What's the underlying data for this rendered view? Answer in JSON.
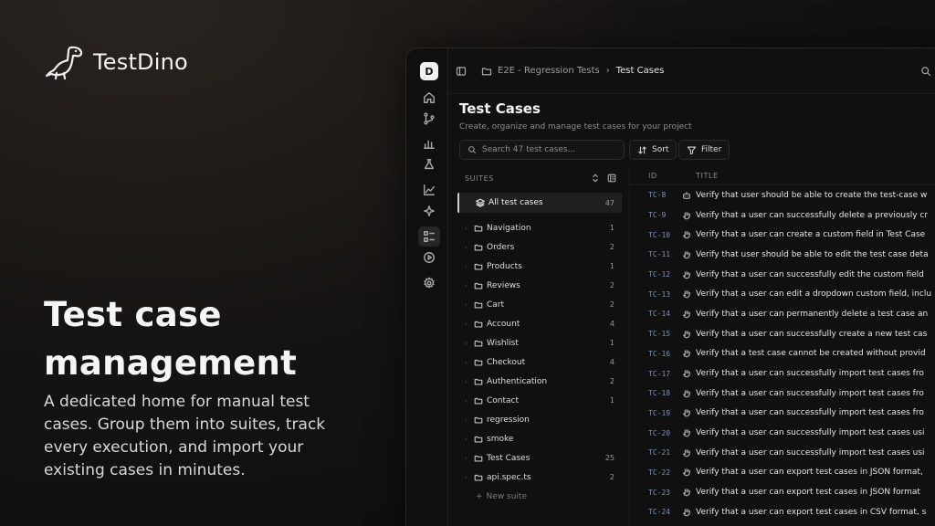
{
  "brand": {
    "name": "TestDino"
  },
  "hero": {
    "headline": "Test case management",
    "description": "A dedicated home for manual test cases. Group them into suites, track every execution, and import your existing cases in minutes."
  },
  "app": {
    "workspace_initial": "D",
    "breadcrumb": {
      "project": "E2E - Regression Tests",
      "page": "Test Cases"
    },
    "page_title": "Test Cases",
    "page_subtitle": "Create, organize and manage test cases for your project",
    "search_placeholder": "Search 47 test cases...",
    "sort_label": "Sort",
    "filter_label": "Filter",
    "suites_header": "SUITES",
    "all_cases": {
      "label": "All test cases",
      "count": "47"
    },
    "suites": [
      {
        "name": "Navigation",
        "count": "1"
      },
      {
        "name": "Orders",
        "count": "2"
      },
      {
        "name": "Products",
        "count": "1"
      },
      {
        "name": "Reviews",
        "count": "2"
      },
      {
        "name": "Cart",
        "count": "2"
      },
      {
        "name": "Account",
        "count": "4"
      },
      {
        "name": "Wishlist",
        "count": "1"
      },
      {
        "name": "Checkout",
        "count": "4"
      },
      {
        "name": "Authentication",
        "count": "2"
      },
      {
        "name": "Contact",
        "count": "1"
      },
      {
        "name": "regression",
        "count": ""
      },
      {
        "name": "smoke",
        "count": ""
      },
      {
        "name": "Test Cases",
        "count": "25"
      },
      {
        "name": "api.spec.ts",
        "count": "2"
      }
    ],
    "new_suite_label": "New suite",
    "table_headers": {
      "id": "ID",
      "title": "TITLE"
    },
    "cases": [
      {
        "id": "TC-8",
        "icon": "robot-icon",
        "title": "Verify that user should be able to create the test-case w"
      },
      {
        "id": "TC-9",
        "icon": "hand-icon",
        "title": "Verify that a user can successfully delete a previously cr"
      },
      {
        "id": "TC-10",
        "icon": "hand-icon",
        "title": "Verify that a user can create a custom field in Test Case"
      },
      {
        "id": "TC-11",
        "icon": "hand-icon",
        "title": "Verify that user should be able to edit the test case deta"
      },
      {
        "id": "TC-12",
        "icon": "hand-icon",
        "title": "Verify that a user can successfully edit the custom field"
      },
      {
        "id": "TC-13",
        "icon": "hand-icon",
        "title": "Verify that a user can edit a dropdown custom field, inclu"
      },
      {
        "id": "TC-14",
        "icon": "hand-icon",
        "title": "Verify that a user can permanently delete a test case an"
      },
      {
        "id": "TC-15",
        "icon": "hand-icon",
        "title": "Verify that a user can successfully create a new test cas"
      },
      {
        "id": "TC-16",
        "icon": "hand-icon",
        "title": "Verify that a test case cannot be created without provid"
      },
      {
        "id": "TC-17",
        "icon": "hand-icon",
        "title": "Verify that a user can successfully import test cases fro"
      },
      {
        "id": "TC-18",
        "icon": "hand-icon",
        "title": "Verify that a user can successfully import test cases fro"
      },
      {
        "id": "TC-19",
        "icon": "hand-icon",
        "title": "Verify that a user can successfully import test cases fro"
      },
      {
        "id": "TC-20",
        "icon": "hand-icon",
        "title": "Verify that a user can successfully import test cases usi"
      },
      {
        "id": "TC-21",
        "icon": "hand-icon",
        "title": "Verify that a user can successfully import test cases usi"
      },
      {
        "id": "TC-22",
        "icon": "hand-icon",
        "title": "Verify that a user can export test cases in JSON format,"
      },
      {
        "id": "TC-23",
        "icon": "hand-icon",
        "title": "Verify that a user can export test cases in JSON format"
      },
      {
        "id": "TC-24",
        "icon": "hand-icon",
        "title": "Verify that a user can export test cases in CSV format, s"
      }
    ]
  },
  "colors": {
    "accent_id": "#7f8fb2",
    "background": "#161412",
    "panel": "#101010"
  }
}
